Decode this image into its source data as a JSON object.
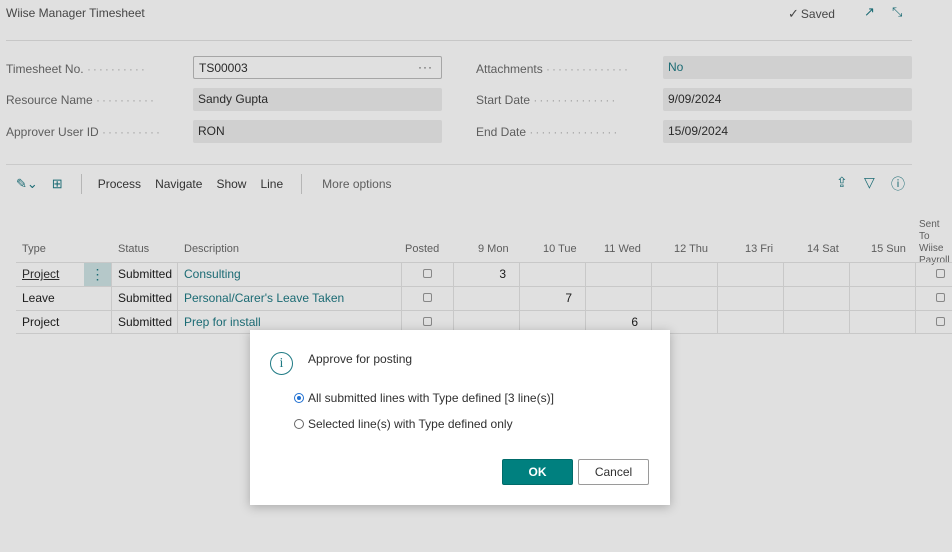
{
  "header": {
    "title": "Wiise Manager Timesheet",
    "saved_label": "Saved"
  },
  "fields": {
    "timesheet_no": {
      "label": "Timesheet No.",
      "value": "TS00003"
    },
    "resource_name": {
      "label": "Resource Name",
      "value": "Sandy Gupta"
    },
    "approver": {
      "label": "Approver User ID",
      "value": "RON"
    },
    "attachments": {
      "label": "Attachments",
      "value": "No"
    },
    "start_date": {
      "label": "Start Date",
      "value": "9/09/2024"
    },
    "end_date": {
      "label": "End Date",
      "value": "15/09/2024"
    }
  },
  "actionbar": {
    "process": "Process",
    "navigate": "Navigate",
    "show": "Show",
    "line": "Line",
    "more": "More options"
  },
  "columns": {
    "type": "Type",
    "status": "Status",
    "description": "Description",
    "posted": "Posted",
    "mon": "9 Mon",
    "tue": "10 Tue",
    "wed": "11 Wed",
    "thu": "12 Thu",
    "fri": "13 Fri",
    "sat": "14 Sat",
    "sun": "15 Sun",
    "sent_1": "Sent To",
    "sent_2": "Wiise",
    "sent_3": "Payroll"
  },
  "rows": [
    {
      "type": "Project",
      "status": "Submitted",
      "description": "Consulting",
      "mon": "3",
      "tue": "",
      "wed": ""
    },
    {
      "type": "Leave",
      "status": "Submitted",
      "description": "Personal/Carer's Leave Taken",
      "mon": "",
      "tue": "7",
      "wed": ""
    },
    {
      "type": "Project",
      "status": "Submitted",
      "description": "Prep for install",
      "mon": "",
      "tue": "",
      "wed": "6"
    }
  ],
  "dialog": {
    "title": "Approve for posting",
    "option_all": "All submitted lines with Type defined [3 line(s)]",
    "option_selected": "Selected line(s) with Type defined only",
    "ok": "OK",
    "cancel": "Cancel"
  },
  "icons": {
    "check": "checkmark-icon",
    "open_new": "open-in-new-icon",
    "collapse": "collapse-icon",
    "share": "share-icon",
    "filter": "filter-icon",
    "info": "info-icon"
  },
  "colors": {
    "accent": "#1f7a84",
    "ok_button": "#00807f",
    "radio": "#1f6fd1"
  }
}
